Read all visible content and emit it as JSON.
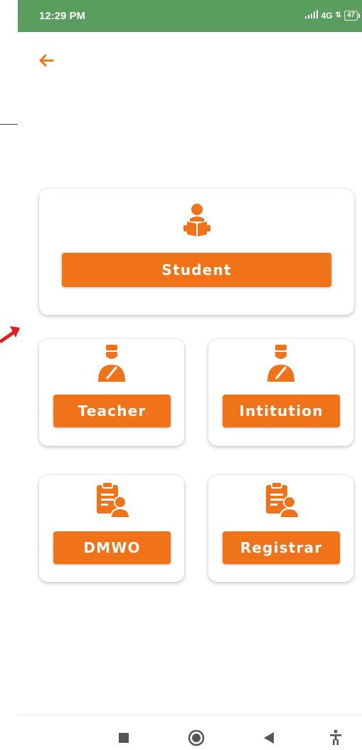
{
  "status_bar": {
    "time": "12:29 PM",
    "network": "4G",
    "battery": "47"
  },
  "colors": {
    "accent": "#f07219",
    "status_bar": "#5a9e5f"
  },
  "header": {
    "back_icon": "arrow-left-icon"
  },
  "cards": {
    "student": {
      "label": "Student",
      "icon": "reading-student-icon"
    },
    "teacher": {
      "label": "Teacher",
      "icon": "person-icon"
    },
    "institution": {
      "label": "Intitution",
      "icon": "person-icon"
    },
    "dmwo": {
      "label": "DMWO",
      "icon": "clipboard-user-icon"
    },
    "registrar": {
      "label": "Registrar",
      "icon": "clipboard-user-icon"
    }
  },
  "nav_bar": {
    "items": [
      "stop-square-icon",
      "home-circle-icon",
      "back-triangle-icon",
      "accessibility-icon"
    ]
  }
}
